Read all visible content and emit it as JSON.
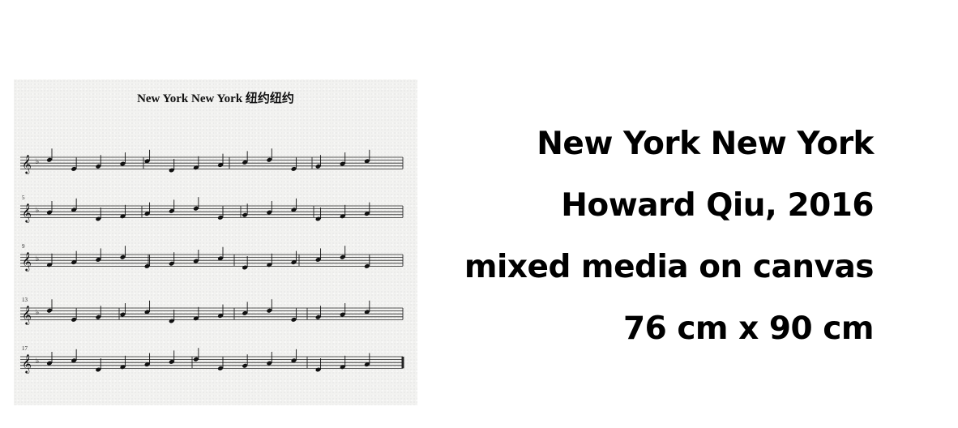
{
  "artwork": {
    "score_title": "New York New York 纽约纽约",
    "measure_numbers": [
      "5",
      "9",
      "13",
      "17"
    ]
  },
  "caption": {
    "title": "New York New York",
    "artist_year": "Howard Qiu, 2016",
    "medium": "mixed media on canvas",
    "dimensions": "76 cm x 90 cm"
  }
}
